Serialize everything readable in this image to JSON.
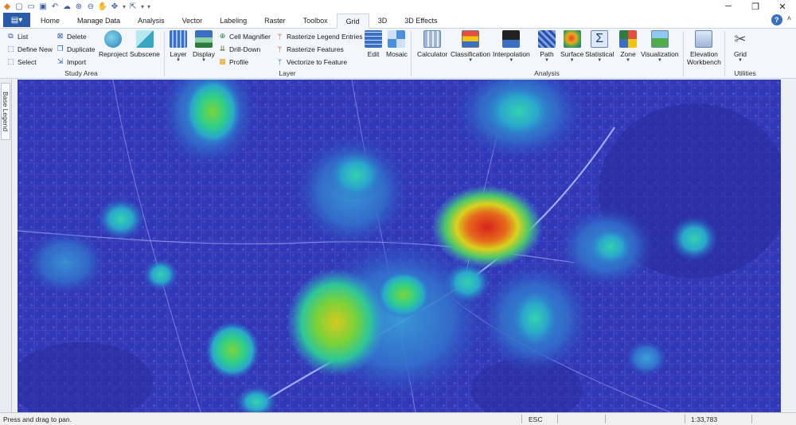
{
  "window": {
    "controls": [
      "─",
      "❐",
      "✕"
    ]
  },
  "tabs": [
    {
      "label": "Home"
    },
    {
      "label": "Manage Data"
    },
    {
      "label": "Analysis"
    },
    {
      "label": "Vector"
    },
    {
      "label": "Labeling"
    },
    {
      "label": "Raster"
    },
    {
      "label": "Toolbox"
    },
    {
      "label": "Grid",
      "active": true
    },
    {
      "label": "3D"
    },
    {
      "label": "3D Effects"
    }
  ],
  "ribbon": {
    "study_area": {
      "label": "Study Area",
      "list": "List",
      "define_new": "Define New",
      "select": "Select",
      "delete": "Delete",
      "duplicate": "Duplicate",
      "import": "Import",
      "reproject": "Reproject",
      "subscene": "Subscene"
    },
    "layer": {
      "label": "Layer",
      "layer": "Layer",
      "display": "Display",
      "cell_magnifier": "Cell Magnifier",
      "drill_down": "Drill-Down",
      "profile": "Profile",
      "rasterize_legend_entries": "Rasterize Legend Entries",
      "rasterize_features": "Rasterize Features",
      "vectorize_to_feature": "Vectorize to Feature"
    },
    "analysis": {
      "label": "Analysis",
      "edit": "Edit",
      "mosaic": "Mosaic",
      "calculator": "Calculator",
      "classification": "Classification",
      "interpolation": "Interpolation",
      "path": "Path",
      "surface": "Surface",
      "statistical": "Statistical",
      "zone": "Zone",
      "visualization": "Visualization",
      "elevation_workbench_1": "Elevation",
      "elevation_workbench_2": "Workbench"
    },
    "utilities": {
      "label": "Utilities",
      "grid": "Grid"
    }
  },
  "left_rail": {
    "base_legend": "Base Legend"
  },
  "status": {
    "message": "Press and drag to pan.",
    "key": "ESC",
    "scale": "1:33,783"
  },
  "colors": {
    "accent": "#2a5aa8",
    "heat_low": "#2d39b8",
    "heat_mid": "#2ecf8a",
    "heat_high": "#e0261c"
  }
}
